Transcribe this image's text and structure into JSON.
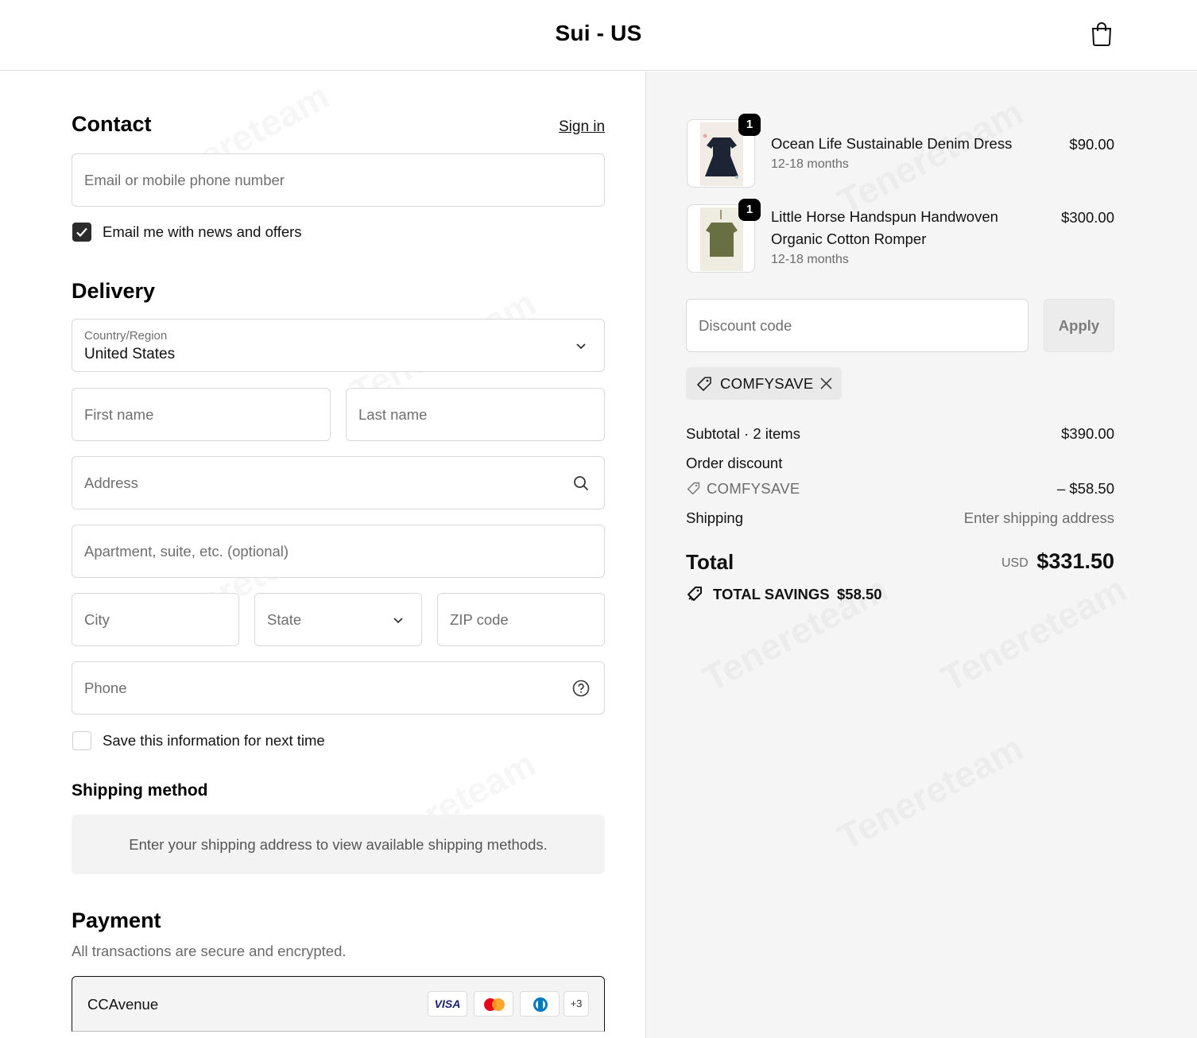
{
  "header": {
    "store_title": "Sui - US",
    "cart_icon": "shopping-bag-icon"
  },
  "contact": {
    "heading": "Contact",
    "sign_in_label": "Sign in",
    "email_placeholder": "Email or mobile phone number",
    "newsletter_label": "Email me with news and offers",
    "newsletter_checked": true
  },
  "delivery": {
    "heading": "Delivery",
    "country_label": "Country/Region",
    "country_value": "United States",
    "first_name_placeholder": "First name",
    "last_name_placeholder": "Last name",
    "address_placeholder": "Address",
    "apartment_placeholder": "Apartment, suite, etc. (optional)",
    "city_placeholder": "City",
    "state_placeholder": "State",
    "zip_placeholder": "ZIP code",
    "phone_placeholder": "Phone",
    "save_info_label": "Save this information for next time",
    "save_info_checked": false
  },
  "shipping_method": {
    "heading": "Shipping method",
    "notice": "Enter your shipping address to view available shipping methods."
  },
  "payment": {
    "heading": "Payment",
    "subtitle": "All transactions are secure and encrypted.",
    "provider": "CCAvenue",
    "cards": [
      "VISA",
      "mastercard-icon",
      "diners-club-icon"
    ],
    "more_cards": "+3"
  },
  "cart": {
    "items": [
      {
        "name_line1": "Ocean Life Sustainable Denim Dress",
        "name_line2": "",
        "variant": "12-18 months",
        "price": "$90.00",
        "quantity": "1"
      },
      {
        "name_line1": "Little Horse Handspun Handwoven",
        "name_line2": "Organic Cotton Romper",
        "variant": "12-18 months",
        "price": "$300.00",
        "quantity": "1"
      }
    ],
    "discount_placeholder": "Discount code",
    "apply_label": "Apply",
    "applied_code": "COMFYSAVE",
    "subtotal_label": "Subtotal · 2 items",
    "subtotal_value": "$390.00",
    "order_discount_label": "Order discount",
    "order_discount_code": "COMFYSAVE",
    "order_discount_value": "– $58.50",
    "shipping_label": "Shipping",
    "shipping_value": "Enter shipping address",
    "total_label": "Total",
    "total_currency": "USD",
    "total_value": "$331.50",
    "savings_label": "TOTAL SAVINGS",
    "savings_value": "$58.50"
  },
  "watermark": "Tenereteam"
}
